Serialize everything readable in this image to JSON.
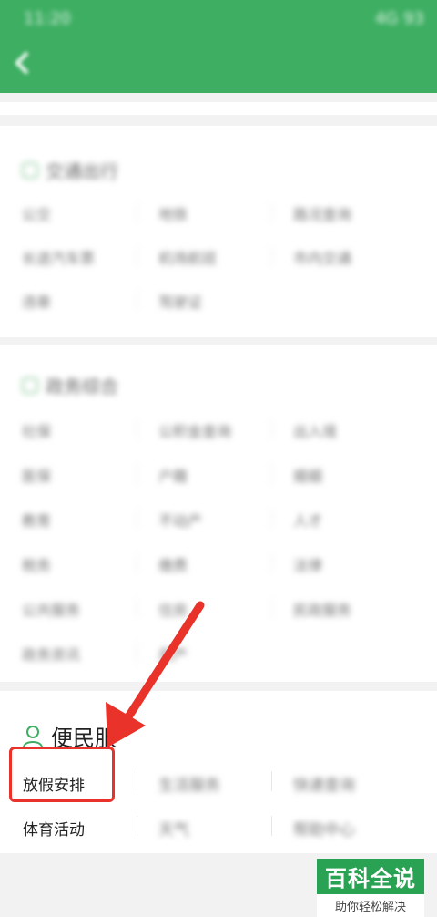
{
  "app": {
    "status_time": "11:20",
    "status_right": "4G 93",
    "header_color": "#3dae62"
  },
  "sections": {
    "traffic": {
      "title": "交通出行",
      "rows": [
        [
          "公交",
          "地铁",
          "路况查询"
        ],
        [
          "长途汽车票",
          "机场航班",
          "市内交通"
        ],
        [
          "违章",
          "驾驶证",
          ""
        ]
      ]
    },
    "affairs": {
      "title": "政务综合",
      "rows": [
        [
          "社保",
          "公积金查询",
          "出入境"
        ],
        [
          "医保",
          "户籍",
          "婚姻"
        ],
        [
          "教育",
          "不动产",
          "人才"
        ],
        [
          "税务",
          "缴费",
          "法律"
        ],
        [
          "公共服务",
          "住房",
          "民政服务"
        ],
        [
          "政务资讯",
          "房产",
          ""
        ]
      ]
    },
    "services": {
      "title": "便民服",
      "rows": [
        [
          "放假安排",
          "生活服务",
          "快递查询"
        ],
        [
          "体育活动",
          "天气",
          "帮助中心"
        ]
      ]
    }
  },
  "annotation": {
    "highlight_color": "#e8322a",
    "target": "放假安排"
  },
  "watermark": {
    "logo": "百科全说",
    "sub": "助你轻松解决"
  }
}
